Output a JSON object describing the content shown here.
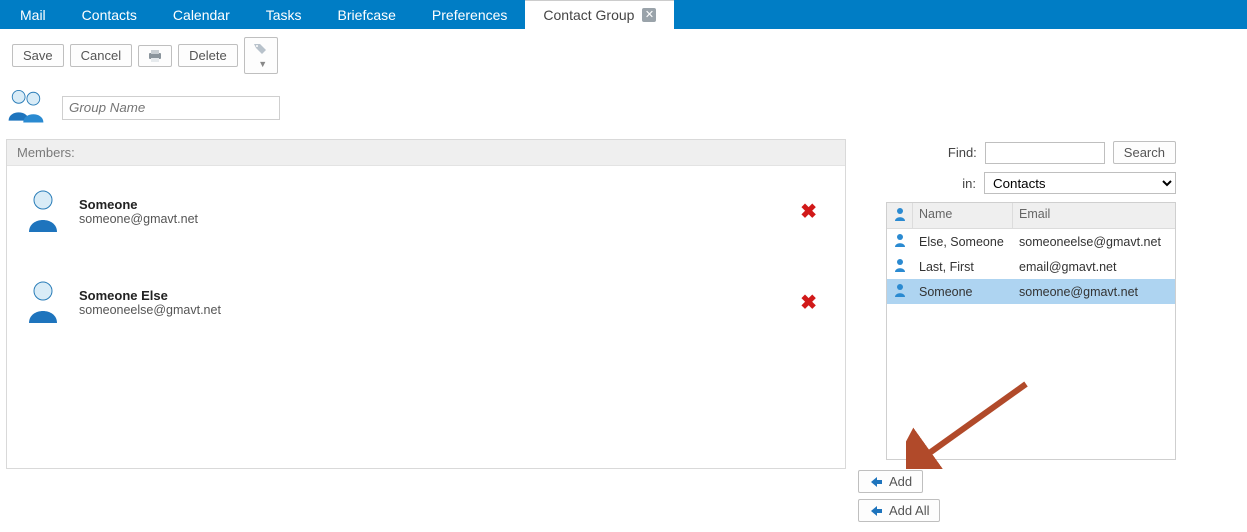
{
  "tabs": [
    {
      "label": "Mail"
    },
    {
      "label": "Contacts"
    },
    {
      "label": "Calendar"
    },
    {
      "label": "Tasks"
    },
    {
      "label": "Briefcase"
    },
    {
      "label": "Preferences"
    },
    {
      "label": "Contact Group",
      "active": true,
      "closable": true
    }
  ],
  "toolbar": {
    "save_label": "Save",
    "cancel_label": "Cancel",
    "delete_label": "Delete"
  },
  "group": {
    "name_placeholder": "Group Name",
    "name_value": ""
  },
  "members_header": "Members:",
  "members": [
    {
      "name": "Someone",
      "email": "someone@gmavt.net"
    },
    {
      "name": "Someone Else",
      "email": "someoneelse@gmavt.net"
    }
  ],
  "picker": {
    "find_label": "Find:",
    "find_value": "",
    "search_label": "Search",
    "in_label": "in:",
    "in_selected": "Contacts",
    "columns": {
      "name": "Name",
      "email": "Email"
    },
    "rows": [
      {
        "name": "Else, Someone",
        "email": "someoneelse@gmavt.net",
        "selected": false
      },
      {
        "name": "Last, First",
        "email": "email@gmavt.net",
        "selected": false
      },
      {
        "name": "Someone",
        "email": "someone@gmavt.net",
        "selected": true
      }
    ],
    "add_label": "Add",
    "add_all_label": "Add All"
  }
}
